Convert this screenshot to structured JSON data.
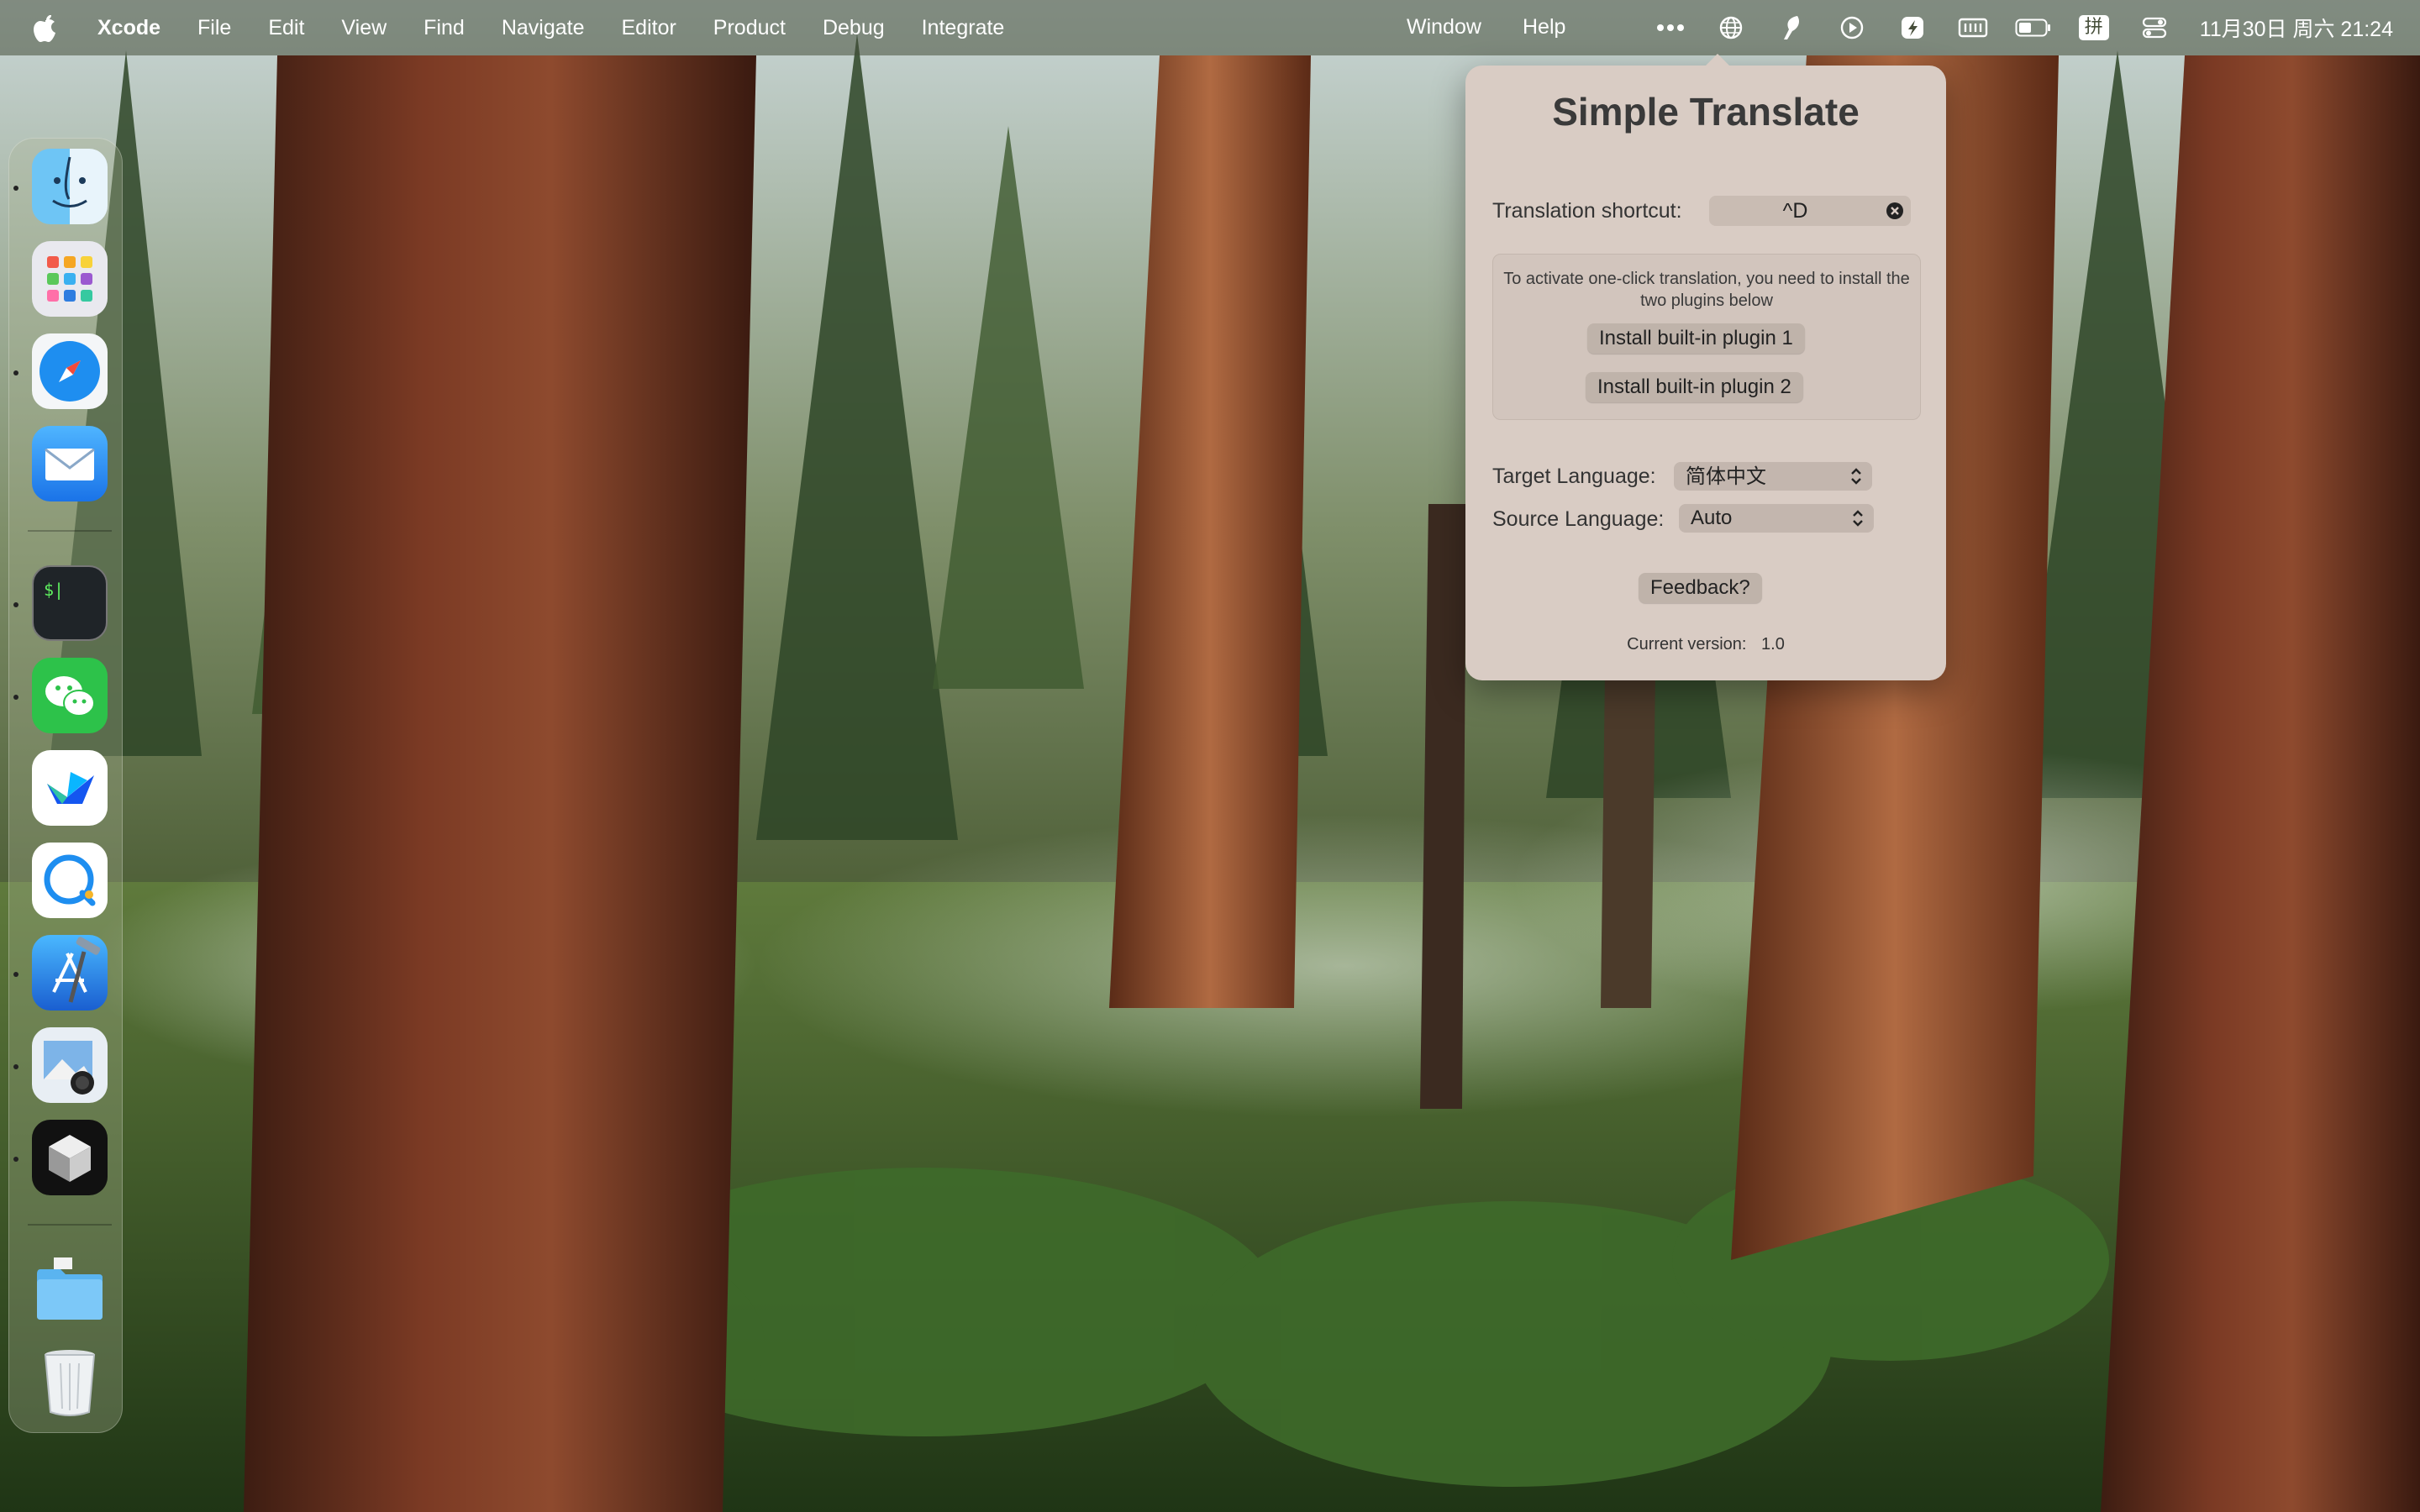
{
  "menubar": {
    "app_name": "Xcode",
    "menus": [
      "File",
      "Edit",
      "View",
      "Find",
      "Navigate",
      "Editor",
      "Product",
      "Debug",
      "Integrate"
    ],
    "window_menu": "Window",
    "help_menu": "Help",
    "status_items": [
      "more-icon",
      "globe-icon",
      "feather-icon",
      "play-icon",
      "script-icon",
      "memory-icon",
      "battery-icon"
    ],
    "input_method": "拼",
    "clock": "11月30日 周六 21:24"
  },
  "dock": {
    "apps": [
      "Finder",
      "Launchpad",
      "Safari",
      "Mail",
      "Terminal",
      "WeChat",
      "Feishu",
      "Chat",
      "Xcode",
      "Preview",
      "3D Viewer",
      "Folder",
      "Trash"
    ]
  },
  "popover": {
    "title": "Simple Translate",
    "shortcut_label": "Translation shortcut:",
    "shortcut_value": "^D",
    "plugin_note": "To activate one-click translation, you need to install the two plugins below",
    "plugin1_button": "Install built-in plugin 1",
    "plugin2_button": "Install built-in plugin 2",
    "target_label": "Target Language:",
    "target_value": "简体中文",
    "source_label": "Source Language:",
    "source_value": "Auto",
    "feedback_button": "Feedback?",
    "version_label": "Current version:",
    "version_value": "1.0"
  },
  "colors": {
    "popover_bg": "#d9ccc4",
    "menubar_bg": "#464e3a"
  }
}
